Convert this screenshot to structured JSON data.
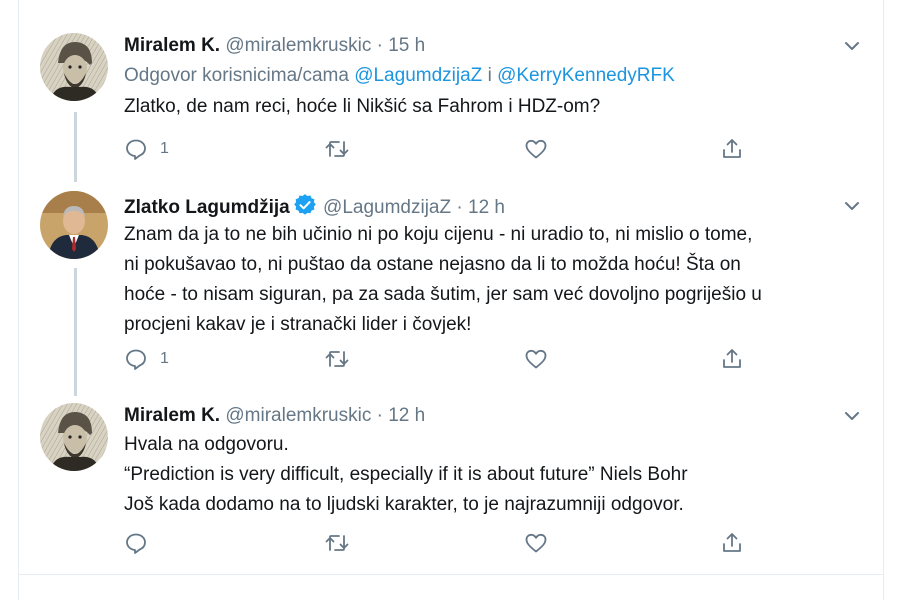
{
  "tweets": [
    {
      "name": "Miralem K.",
      "handle": "@miralemkruskic",
      "separator": "·",
      "time": "15 h",
      "reply_prefix": "Odgovor korisnicima/cama",
      "reply_mention_1": "@LagumdzijaZ",
      "reply_and": "i",
      "reply_mention_2": "@KerryKennedyRFK",
      "lines": [
        "Zlatko, de nam reci, hoće li Nikšić sa Fahrom i HDZ-om?"
      ],
      "reply_count": "1",
      "avatar_icon": "portrait-engraving-icon"
    },
    {
      "name": "Zlatko Lagumdžija",
      "verified": true,
      "handle": "@LagumdzijaZ",
      "separator": "·",
      "time": "12 h",
      "lines": [
        "Znam da ja to ne bih učinio ni po koju cijenu - ni uradio to, ni mislio o tome,",
        "ni pokušavao to, ni puštao da ostane nejasno da li to možda hoću! Šta on",
        "hoće - to nisam siguran, pa za sada šutim, jer sam već dovoljno pogriješio u",
        "procjeni kakav je i stranački lider i čovjek!"
      ],
      "reply_count": "1",
      "avatar_icon": "man-in-suit-photo-icon"
    },
    {
      "name": "Miralem K.",
      "handle": "@miralemkruskic",
      "separator": "·",
      "time": "12 h",
      "lines": [
        "Hvala na odgovoru.",
        "“Prediction is very difficult, especially if it is about future” Niels Bohr",
        "Još kada dodamo na to ljudski karakter, to je najrazumniji odgovor."
      ],
      "reply_count": "",
      "avatar_icon": "portrait-engraving-icon"
    }
  ],
  "colors": {
    "link": "#1b95e0",
    "secondary": "#657786",
    "thread_line": "#ccd6dd",
    "verified": "#1da1f2"
  }
}
